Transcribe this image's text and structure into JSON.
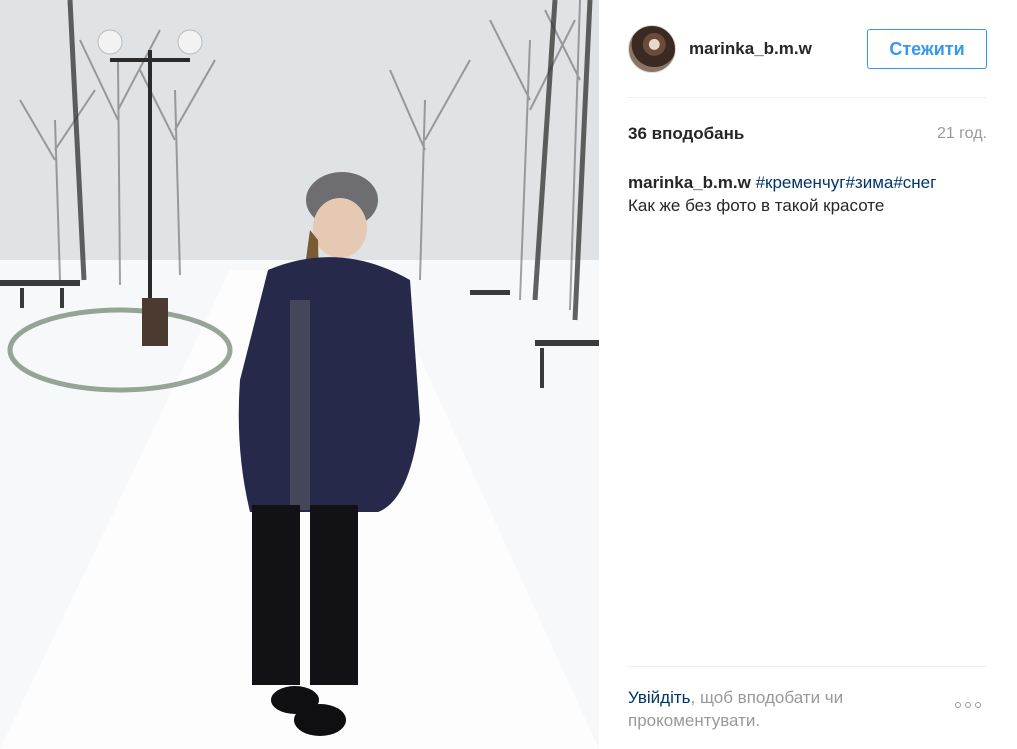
{
  "post": {
    "username": "marinka_b.m.w",
    "follow_label": "Стежити",
    "likes": "36 вподобань",
    "time_ago": "21 год.",
    "caption": {
      "user": "marinka_b.m.w",
      "hashtags": [
        "#кременчуг",
        "#зима",
        "#снег"
      ],
      "text": "Как же без фото в такой красоте"
    }
  },
  "footer": {
    "login_link": "Увійдіть",
    "login_rest": ", щоб вподобати чи прокоментувати."
  },
  "colors": {
    "accent": "#3897f0",
    "hashtag": "#003569",
    "muted": "#999999",
    "text": "#262626"
  },
  "icons": {
    "more": "more-options-icon",
    "avatar": "avatar"
  }
}
